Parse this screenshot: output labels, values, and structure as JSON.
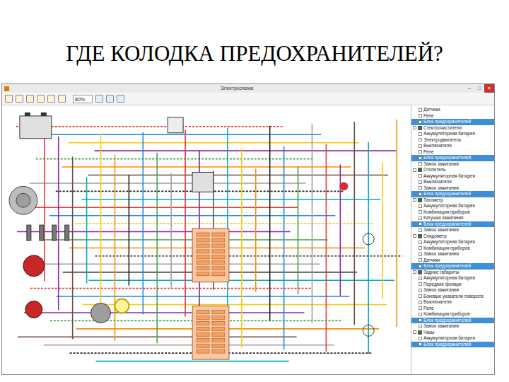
{
  "slide": {
    "title": "ГДЕ КОЛОДКА ПРЕДОХРАНИТЕЛЕЙ?"
  },
  "window": {
    "title": "Электросхема",
    "controls": [
      "–",
      "□",
      "✕"
    ]
  },
  "toolbar": {
    "zoom": "80%"
  },
  "tree": [
    {
      "label": "Датчики",
      "kind": "item",
      "checked": false,
      "selected": false
    },
    {
      "label": "Реле",
      "kind": "item",
      "checked": false,
      "selected": false
    },
    {
      "label": "Блок предохранителей",
      "kind": "item",
      "checked": false,
      "selected": true
    },
    {
      "label": "Стеклоочистители",
      "kind": "group",
      "checked": true,
      "selected": false
    },
    {
      "label": "Аккумуляторная батарея",
      "kind": "item",
      "checked": false,
      "selected": false
    },
    {
      "label": "Электродвигатель",
      "kind": "item",
      "checked": false,
      "selected": false
    },
    {
      "label": "Выключатели",
      "kind": "item",
      "checked": false,
      "selected": false
    },
    {
      "label": "Реле",
      "kind": "item",
      "checked": false,
      "selected": false
    },
    {
      "label": "Блок предохранителей",
      "kind": "item",
      "checked": false,
      "selected": true
    },
    {
      "label": "Замок зажигания",
      "kind": "item",
      "checked": false,
      "selected": false
    },
    {
      "label": "Отопитель",
      "kind": "group",
      "checked": true,
      "selected": false
    },
    {
      "label": "Аккумуляторная батарея",
      "kind": "item",
      "checked": false,
      "selected": false
    },
    {
      "label": "Выключатели",
      "kind": "item",
      "checked": false,
      "selected": false
    },
    {
      "label": "Замок зажигания",
      "kind": "item",
      "checked": false,
      "selected": false
    },
    {
      "label": "Блок предохранителей",
      "kind": "item",
      "checked": false,
      "selected": true
    },
    {
      "label": "Тахометр",
      "kind": "group",
      "checked": true,
      "selected": false
    },
    {
      "label": "Аккумуляторная батарея",
      "kind": "item",
      "checked": false,
      "selected": false
    },
    {
      "label": "Комбинация приборов",
      "kind": "item",
      "checked": false,
      "selected": false
    },
    {
      "label": "Катушка зажигания",
      "kind": "item",
      "checked": false,
      "selected": false
    },
    {
      "label": "Блок предохранителей",
      "kind": "item",
      "checked": false,
      "selected": true
    },
    {
      "label": "Замок зажигания",
      "kind": "item",
      "checked": false,
      "selected": false
    },
    {
      "label": "Спидометр",
      "kind": "group",
      "checked": true,
      "selected": false
    },
    {
      "label": "Аккумуляторная батарея",
      "kind": "item",
      "checked": false,
      "selected": false
    },
    {
      "label": "Комбинация приборов",
      "kind": "item",
      "checked": false,
      "selected": false
    },
    {
      "label": "Замок зажигания",
      "kind": "item",
      "checked": false,
      "selected": false
    },
    {
      "label": "Датчики",
      "kind": "item",
      "checked": false,
      "selected": false
    },
    {
      "label": "Блок предохранителей",
      "kind": "item",
      "checked": false,
      "selected": true
    },
    {
      "label": "Задние габариты",
      "kind": "group",
      "checked": true,
      "selected": false
    },
    {
      "label": "Аккумуляторная батарея",
      "kind": "item",
      "checked": false,
      "selected": false
    },
    {
      "label": "Передние фонари",
      "kind": "item",
      "checked": false,
      "selected": false
    },
    {
      "label": "Замок зажигания",
      "kind": "item",
      "checked": false,
      "selected": false
    },
    {
      "label": "Боковые указатели поворота",
      "kind": "item",
      "checked": false,
      "selected": false
    },
    {
      "label": "Выключатели",
      "kind": "item",
      "checked": false,
      "selected": false
    },
    {
      "label": "Реле",
      "kind": "item",
      "checked": false,
      "selected": false
    },
    {
      "label": "Комбинация приборов",
      "kind": "item",
      "checked": false,
      "selected": false
    },
    {
      "label": "Блок предохранителей",
      "kind": "item",
      "checked": false,
      "selected": true
    },
    {
      "label": "Замок зажигания",
      "kind": "item",
      "checked": false,
      "selected": false
    },
    {
      "label": "Часы",
      "kind": "group",
      "checked": true,
      "selected": false
    },
    {
      "label": "Аккумуляторная батарея",
      "kind": "item",
      "checked": false,
      "selected": false
    },
    {
      "label": "Блок предохранителей",
      "kind": "item",
      "checked": false,
      "selected": true
    }
  ]
}
